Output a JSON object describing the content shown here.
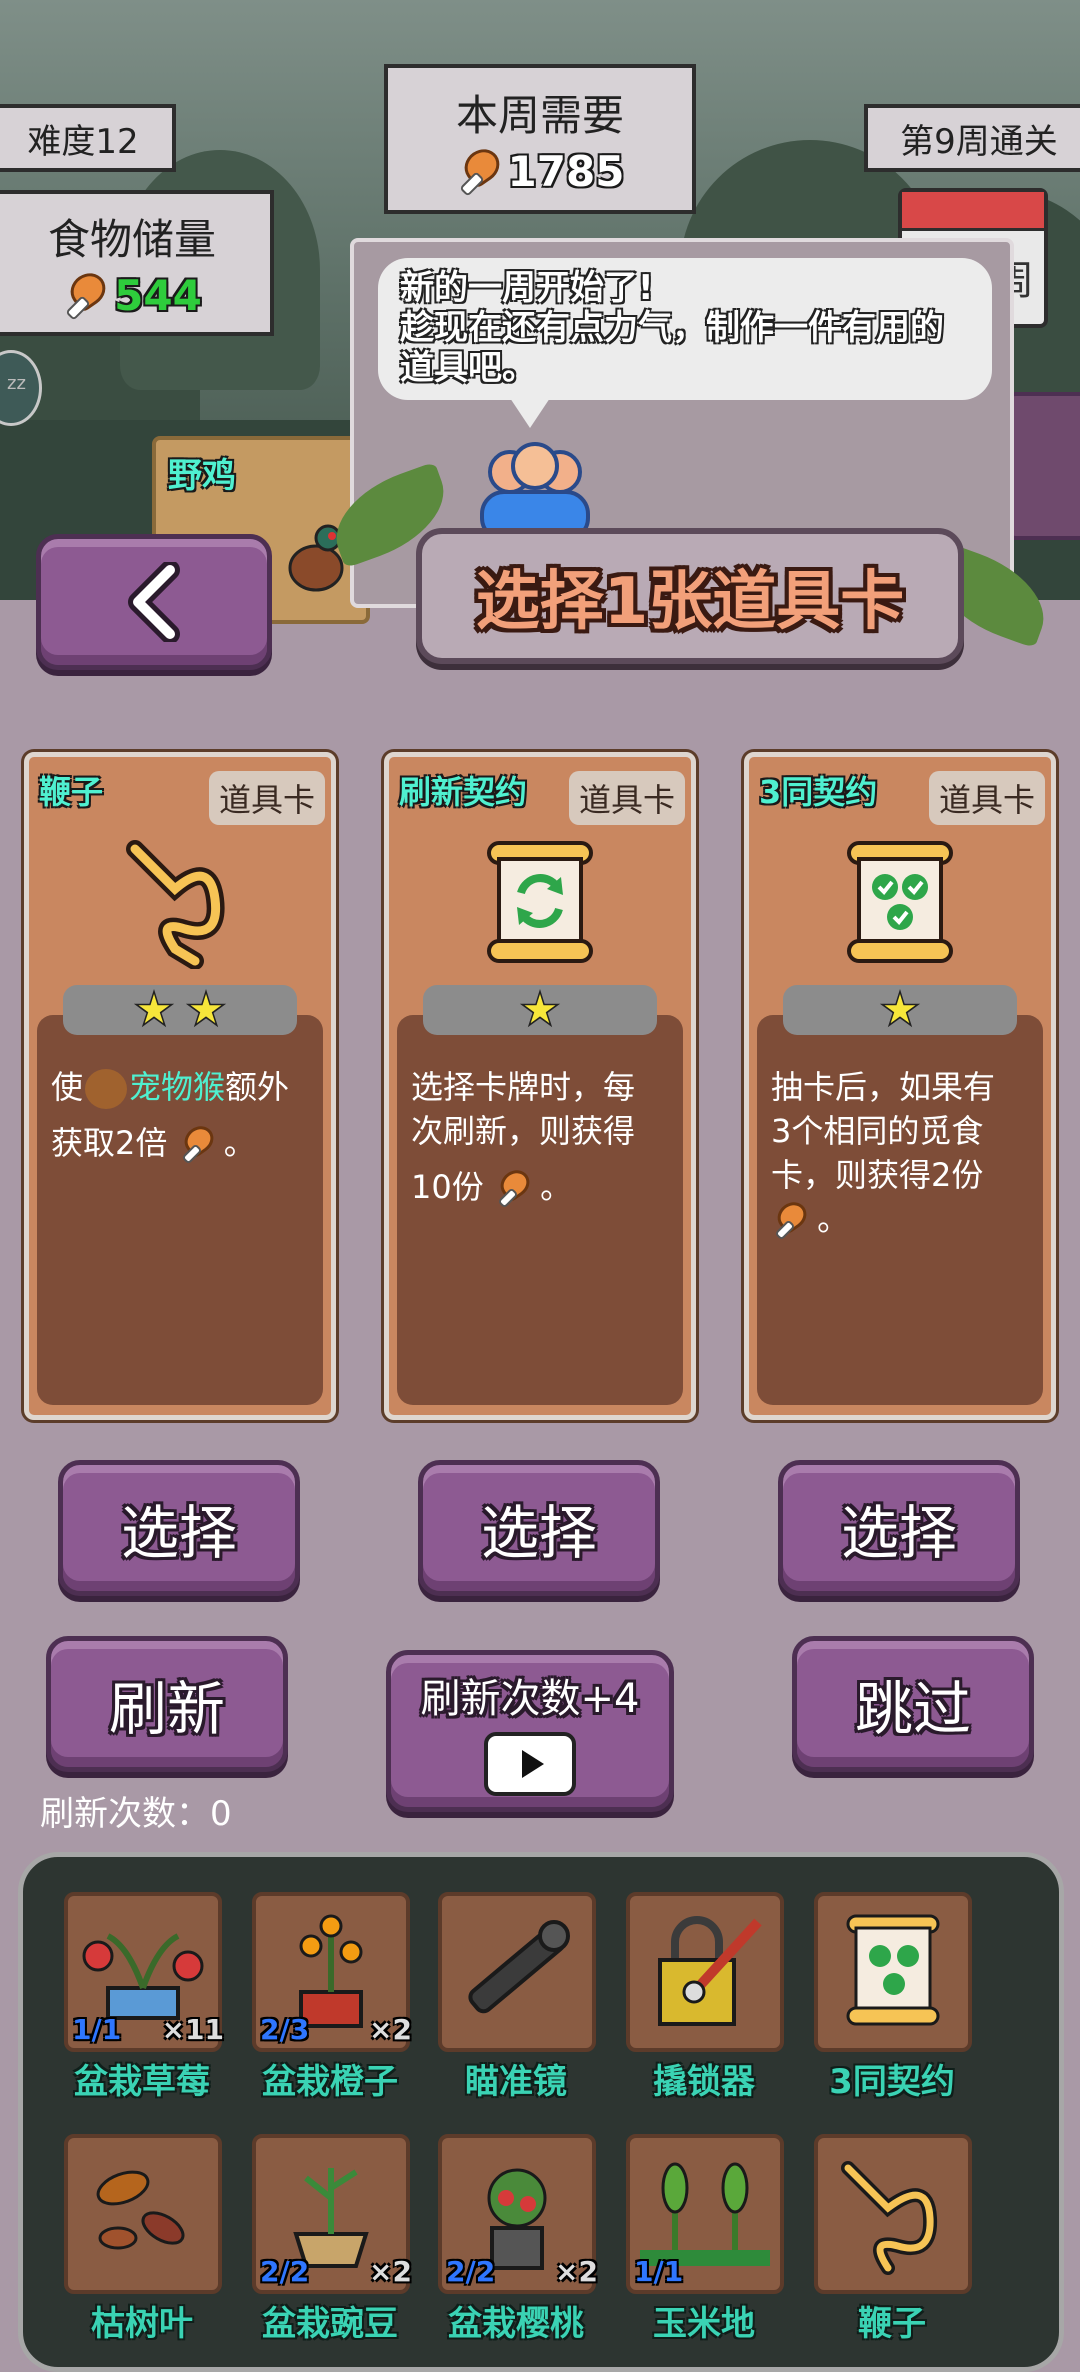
{
  "hud": {
    "difficulty": "难度12",
    "weekly_need_title": "本周需要",
    "weekly_need_value": "1785",
    "food_storage_title": "食物储量",
    "food_storage_value": "544",
    "week_clear": "第9周通关",
    "calendar_fragment": "周"
  },
  "dialog": {
    "line1": "新的一周开始了!",
    "line2": "趁现在还有点力气，制作一件有用的",
    "line3": "道具吧。"
  },
  "scene": {
    "animal_label": "野鸡"
  },
  "header": {
    "title": "选择1张道具卡"
  },
  "cards": [
    {
      "name": "鞭子",
      "type": "道具卡",
      "stars": 2,
      "desc_a": "使",
      "desc_pet": "宠物猴",
      "desc_b": "额外",
      "desc_c": "获取2倍",
      "desc_d": "。"
    },
    {
      "name": "刷新契约",
      "type": "道具卡",
      "stars": 1,
      "desc_a": "选择卡牌时，每",
      "desc_b": "次刷新，则获得",
      "desc_c": "10份",
      "desc_d": "。"
    },
    {
      "name": "3同契约",
      "type": "道具卡",
      "stars": 1,
      "desc_a": "抽卡后，如果有",
      "desc_b": "3个相同的觅食",
      "desc_c": "卡，则获得2份",
      "desc_d": "。"
    }
  ],
  "actions": {
    "select_label": "选择",
    "refresh_label": "刷新",
    "refresh_plus_label": "刷新次数+4",
    "skip_label": "跳过",
    "refresh_count_label": "刷新次数：",
    "refresh_count_value": "0"
  },
  "inventory": [
    {
      "label": "盆栽草莓",
      "level": "1/1",
      "count": "×11",
      "icon": "strawberry-plant-icon"
    },
    {
      "label": "盆栽橙子",
      "level": "2/3",
      "count": "×2",
      "icon": "orange-plant-icon"
    },
    {
      "label": "瞄准镜",
      "level": "",
      "count": "",
      "icon": "scope-icon"
    },
    {
      "label": "撬锁器",
      "level": "",
      "count": "",
      "icon": "lockpick-icon"
    },
    {
      "label": "3同契约",
      "level": "",
      "count": "",
      "icon": "contract-icon"
    },
    {
      "label": "枯树叶",
      "level": "",
      "count": "",
      "icon": "dry-leaves-icon"
    },
    {
      "label": "盆栽豌豆",
      "level": "2/2",
      "count": "×2",
      "icon": "pea-plant-icon"
    },
    {
      "label": "盆栽樱桃",
      "level": "2/2",
      "count": "×2",
      "icon": "cherry-plant-icon"
    },
    {
      "label": "玉米地",
      "level": "1/1",
      "count": "",
      "icon": "corn-field-icon"
    },
    {
      "label": "鞭子",
      "level": "",
      "count": "",
      "icon": "whip-icon"
    }
  ],
  "colors": {
    "accent_green": "#2ecc3c",
    "card_name": "#4ff0d0",
    "stone_purple": "#8d5a92",
    "inventory_label": "#3ad3b4"
  }
}
